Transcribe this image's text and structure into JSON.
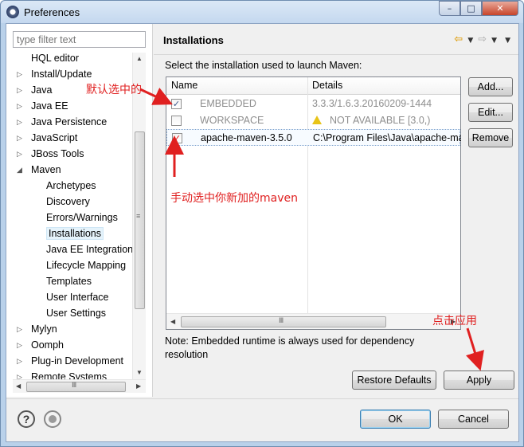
{
  "window": {
    "title": "Preferences",
    "min_symbol": "–",
    "max_symbol": "□",
    "close_symbol": "✕"
  },
  "filter": {
    "placeholder": "type filter text"
  },
  "tree": [
    {
      "label": "HQL editor",
      "level": 0,
      "arrow": ""
    },
    {
      "label": "Install/Update",
      "level": 0,
      "arrow": "▷"
    },
    {
      "label": "Java",
      "level": 0,
      "arrow": "▷"
    },
    {
      "label": "Java EE",
      "level": 0,
      "arrow": "▷"
    },
    {
      "label": "Java Persistence",
      "level": 0,
      "arrow": "▷"
    },
    {
      "label": "JavaScript",
      "level": 0,
      "arrow": "▷"
    },
    {
      "label": "JBoss Tools",
      "level": 0,
      "arrow": "▷"
    },
    {
      "label": "Maven",
      "level": 0,
      "arrow": "◢"
    },
    {
      "label": "Archetypes",
      "level": 1,
      "arrow": ""
    },
    {
      "label": "Discovery",
      "level": 1,
      "arrow": ""
    },
    {
      "label": "Errors/Warnings",
      "level": 1,
      "arrow": ""
    },
    {
      "label": "Installations",
      "level": 1,
      "arrow": "",
      "selected": true
    },
    {
      "label": "Java EE Integration",
      "level": 1,
      "arrow": ""
    },
    {
      "label": "Lifecycle Mapping",
      "level": 1,
      "arrow": ""
    },
    {
      "label": "Templates",
      "level": 1,
      "arrow": ""
    },
    {
      "label": "User Interface",
      "level": 1,
      "arrow": ""
    },
    {
      "label": "User Settings",
      "level": 1,
      "arrow": ""
    },
    {
      "label": "Mylyn",
      "level": 0,
      "arrow": "▷"
    },
    {
      "label": "Oomph",
      "level": 0,
      "arrow": "▷"
    },
    {
      "label": "Plug-in Development",
      "level": 0,
      "arrow": "▷"
    },
    {
      "label": "Remote Systems",
      "level": 0,
      "arrow": "▷"
    }
  ],
  "scroll": {
    "grip": "≡",
    "hgrip": "Ⅲ",
    "up": "▲",
    "down": "▼",
    "left": "◀",
    "right": "▶"
  },
  "page": {
    "heading": "Installations",
    "back_arrow": "⇦",
    "forward_arrow": "⇨",
    "dropdown": "▼",
    "menu": "▼",
    "description": "Select the installation used to launch Maven:",
    "columns": [
      "Name",
      "Details"
    ],
    "rows": [
      {
        "checked": true,
        "name": "EMBEDDED",
        "details": "3.3.3/1.6.3.20160209-1444",
        "greyed": true,
        "warning": false
      },
      {
        "checked": false,
        "name": "WORKSPACE",
        "details": "NOT AVAILABLE [3.0,)",
        "greyed": true,
        "warning": true
      },
      {
        "checked": true,
        "name": "apache-maven-3.5.0",
        "details": "C:\\Program Files\\Java\\apache-ma",
        "greyed": false,
        "warning": false,
        "selected": true
      }
    ],
    "check_mark": "✓",
    "buttons": {
      "add": "Add...",
      "edit": "Edit...",
      "remove": "Remove"
    },
    "note": "Note: Embedded runtime is always used for dependency resolution",
    "restore_defaults": "Restore Defaults",
    "apply": "Apply"
  },
  "footer": {
    "help_symbol": "?",
    "ok": "OK",
    "cancel": "Cancel"
  },
  "annotations": {
    "default_selected": "默认选中的",
    "manual_select": "手动选中你新加的maven",
    "click_apply": "点击应用",
    "color": "#e02020"
  }
}
